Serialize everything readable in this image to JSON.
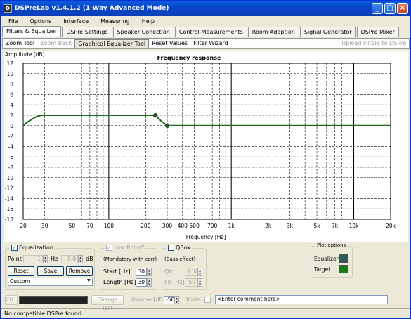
{
  "window": {
    "title": "DSPreLab  v1.4.1.2 (1-Way Advanced Mode)",
    "icon_label": "D"
  },
  "menu": [
    "File",
    "Options",
    "Interface",
    "Measuring",
    "Help"
  ],
  "tabs": [
    "Filters & Equalizer",
    "DSPre Settings",
    "Speaker Conection",
    "Control-Measurements",
    "Room Adaption",
    "Signal Generator",
    "DSPre Mixer"
  ],
  "toolbar": {
    "zoom_tool": "Zoom Tool",
    "zoom_back": "Zoom Back",
    "graphical_eq": "Graphical Equalizer Tool",
    "reset_values": "Reset Values",
    "filter_wizard": "Filter Wizard",
    "upload": "Upload Filters to DSPre"
  },
  "chart_data": {
    "type": "line",
    "title": "Frequency response",
    "xlabel": "Frequency [Hz]",
    "ylabel": "Amplitude [dB]",
    "xscale": "log",
    "xlim": [
      20,
      20000
    ],
    "ylim": [
      -18,
      12
    ],
    "grid": true,
    "yticks": [
      "12",
      "10",
      "8",
      "6",
      "4",
      "2",
      "0",
      "-2",
      "-4",
      "-6",
      "-8",
      "-10",
      "-12",
      "-14",
      "-16",
      "-18"
    ],
    "xticks": [
      {
        "v": 20,
        "l": "20"
      },
      {
        "v": 30,
        "l": "30"
      },
      {
        "v": 50,
        "l": "50"
      },
      {
        "v": 70,
        "l": "70"
      },
      {
        "v": 100,
        "l": "100"
      },
      {
        "v": 200,
        "l": "200"
      },
      {
        "v": 300,
        "l": "300"
      },
      {
        "v": 400,
        "l": "400"
      },
      {
        "v": 500,
        "l": "500"
      },
      {
        "v": 700,
        "l": "700"
      },
      {
        "v": 1000,
        "l": "1k"
      },
      {
        "v": 2000,
        "l": "2k"
      },
      {
        "v": 3000,
        "l": "3k"
      },
      {
        "v": 5000,
        "l": "5k"
      },
      {
        "v": 7000,
        "l": "7k"
      },
      {
        "v": 10000,
        "l": "10k"
      },
      {
        "v": 20000,
        "l": "20k"
      }
    ],
    "series": [
      {
        "name": "Target",
        "color": "#1a6b1a",
        "x": [
          20,
          22,
          25,
          28,
          35,
          100,
          240,
          270,
          300,
          20000
        ],
        "y": [
          0,
          0.8,
          1.6,
          2,
          2,
          2,
          2,
          0.8,
          0,
          0
        ]
      }
    ],
    "markers": [
      {
        "x": 240,
        "y": 2
      },
      {
        "x": 300,
        "y": 0
      }
    ]
  },
  "equalization": {
    "label": "Equalization",
    "point_label": "Point",
    "point_value": "1",
    "hz_label": "Hz",
    "hz_value": "0.0",
    "db_label": "dB",
    "reset": "Reset",
    "save": "Save",
    "remove": "Remove",
    "preset": "Custom"
  },
  "low_rolloff": {
    "label": "Low Rolloff",
    "note": "(Mandatory with corr)",
    "start_label": "Start [Hz]",
    "start_value": "30",
    "length_label": "Length [Hz]",
    "length_value": "30"
  },
  "qbox": {
    "label": "QBox",
    "note": "(Bass effect)",
    "qtc_label": "Qtc",
    "qtc_value": "0.50",
    "fb_label": "Fb [Hz]",
    "fb_value": "50"
  },
  "plot_options": {
    "title": "Plot options",
    "equalizer": "Equalizer",
    "target": "Target",
    "equalizer_color": "#2f5a5a",
    "target_color": "#1a7a1a"
  },
  "bottom": {
    "channel": "CH1",
    "change_text": "Change Text",
    "volume_label": "Volume [dB]",
    "volume_value": "-50",
    "mute_label": "Mute",
    "comment": "<Enter comment here>"
  },
  "status": "No compatible DSPre found"
}
